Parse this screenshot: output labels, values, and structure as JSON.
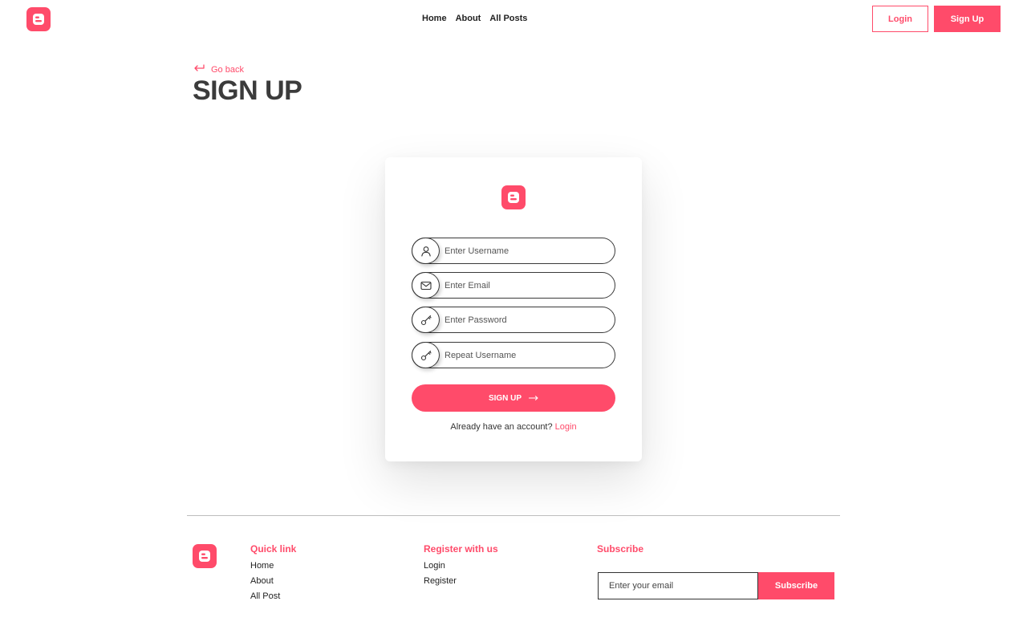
{
  "brand": {
    "accent_color": "#FF4B6A",
    "logo_icon": "blogger-logo-icon"
  },
  "header": {
    "nav": [
      {
        "label": "Home"
      },
      {
        "label": "About"
      },
      {
        "label": "All Posts"
      }
    ],
    "login_label": "Login",
    "signup_label": "Sign Up"
  },
  "page": {
    "go_back_label": "Go back",
    "title": "SIGN UP"
  },
  "form": {
    "fields": [
      {
        "icon": "user-icon",
        "placeholder": "Enter Username",
        "value": ""
      },
      {
        "icon": "mail-icon",
        "placeholder": "Enter Email",
        "value": ""
      },
      {
        "icon": "key-icon",
        "placeholder": "Enter Password",
        "value": ""
      },
      {
        "icon": "key-icon",
        "placeholder": "Repeat Username",
        "value": ""
      }
    ],
    "submit_label": "SIGN UP",
    "footer_text": "Already have an account?",
    "footer_link": "Login"
  },
  "footer": {
    "quick_links": {
      "title": "Quick link",
      "items": [
        "Home",
        "About",
        "All Post"
      ]
    },
    "register": {
      "title": "Register with us",
      "items": [
        "Login",
        "Register"
      ]
    },
    "subscribe": {
      "title": "Subscribe",
      "placeholder": "Enter your email",
      "button_label": "Subscribe"
    }
  }
}
